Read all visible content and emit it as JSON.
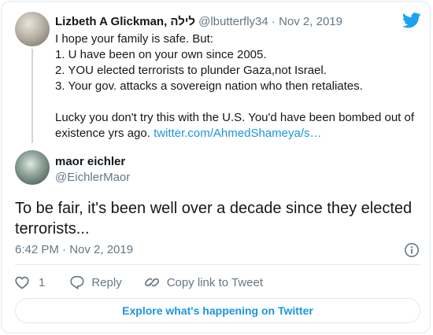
{
  "parent_tweet": {
    "author_name": "Lizbeth A Glickman, לילה",
    "author_handle": "@lbutterfly34",
    "date": "Nov 2, 2019",
    "lines": [
      "I hope your family is safe. But:",
      "1. U have been on your own since 2005.",
      "2. YOU elected terrorists to plunder Gaza,not Israel.",
      "3. Your gov. attacks a sovereign nation who then retaliates.",
      "",
      "Lucky you don't try this with the U.S. You'd have been bombed out of",
      "existence yrs ago."
    ],
    "link_text": "twitter.com/AhmedShameya/s…"
  },
  "main_tweet": {
    "author_name": "maor eichler",
    "author_handle": "@EichlerMaor",
    "text": "To be fair, it's been well over a decade since they elected terrorists...",
    "timestamp": "6:42 PM · Nov 2, 2019"
  },
  "actions": {
    "like_count": "1",
    "reply_label": "Reply",
    "copy_link_label": "Copy link to Tweet"
  },
  "explore_label": "Explore what's happening on Twitter",
  "icons": {
    "brand": "twitter-bird-icon",
    "info": "info-icon",
    "like": "heart-icon",
    "reply": "speech-bubble-icon",
    "copy": "link-icon"
  },
  "colors": {
    "brand": "#1da1f2",
    "link": "#1b95e0",
    "muted": "#657786",
    "border": "#e1e8ed"
  }
}
